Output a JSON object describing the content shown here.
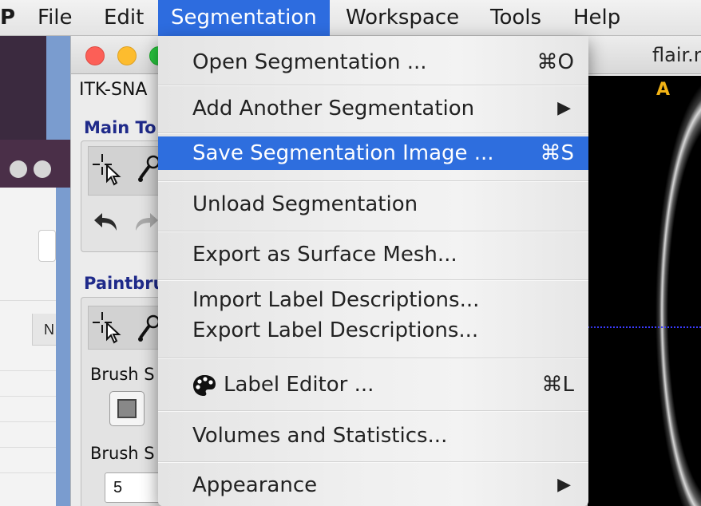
{
  "menubar": {
    "app_label": "P",
    "items": [
      "File",
      "Edit",
      "Segmentation",
      "Workspace",
      "Tools",
      "Help"
    ]
  },
  "window": {
    "title": "flair.n",
    "app_name": "ITK-SNA",
    "main_toolbar_title": "Main To",
    "paintbrush_title": "Paintbru",
    "brush_style_label": "Brush S",
    "brush_size_label": "Brush S",
    "brush_size_value": "5"
  },
  "background": {
    "column_header": "N"
  },
  "image_view": {
    "orientation_label": "A"
  },
  "segmentation_menu": {
    "items": [
      {
        "label": "Open Segmentation ...",
        "shortcut": "⌘O",
        "submenu": false
      },
      {
        "label": "Add Another Segmentation",
        "shortcut": "",
        "submenu": true
      },
      {
        "label": "Save Segmentation Image ...",
        "shortcut": "⌘S",
        "submenu": false,
        "highlighted": true
      },
      {
        "label": "Unload Segmentation",
        "shortcut": "",
        "submenu": false
      },
      {
        "label": "Export as Surface Mesh...",
        "shortcut": "",
        "submenu": false
      },
      {
        "label": "Import Label Descriptions...",
        "shortcut": "",
        "submenu": false
      },
      {
        "label": "Export Label Descriptions...",
        "shortcut": "",
        "submenu": false
      },
      {
        "label": "Label Editor ...",
        "shortcut": "⌘L",
        "submenu": false,
        "icon": "palette-icon"
      },
      {
        "label": "Volumes and Statistics...",
        "shortcut": "",
        "submenu": false
      },
      {
        "label": "Appearance",
        "shortcut": "",
        "submenu": true
      }
    ],
    "submenu_arrow": "▶"
  },
  "colors": {
    "menu_highlight": "#2e6ede",
    "section_title": "#1f2a8a",
    "orientation_label": "#f2b315"
  }
}
